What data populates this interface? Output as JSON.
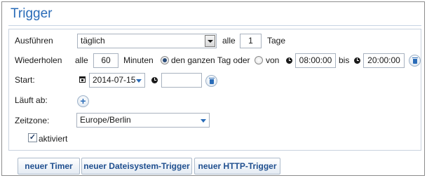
{
  "title": "Trigger",
  "row_execute": {
    "label": "Ausführen",
    "frequency_value": "täglich",
    "every_label": "alle",
    "every_value": "1",
    "unit_label": "Tage"
  },
  "row_repeat": {
    "label": "Wiederholen",
    "every_label": "alle",
    "minutes_value": "60",
    "minutes_label": "Minuten",
    "all_day_label": "den ganzen Tag oder",
    "all_day_selected": true,
    "from_label": "von",
    "from_value": "08:00:00",
    "to_label": "bis",
    "to_value": "20:00:00"
  },
  "row_start": {
    "label": "Start:",
    "date_value": "2014-07-15",
    "time_value": ""
  },
  "row_expires": {
    "label": "Läuft ab:"
  },
  "row_timezone": {
    "label": "Zeitzone:",
    "value": "Europe/Berlin"
  },
  "activated": {
    "label": "aktiviert",
    "checked": true
  },
  "buttons": {
    "new_timer": "neuer Timer",
    "new_filesystem_trigger": "neuer Dateisystem-Trigger",
    "new_http_trigger": "neuer HTTP-Trigger"
  },
  "colors": {
    "accent": "#2a6cb8",
    "button_text": "#1f4f8f",
    "panel_border": "#c9d3df"
  },
  "icons": [
    "calendar-icon",
    "clock-icon",
    "trash-icon",
    "plus-icon",
    "chevron-down-icon"
  ]
}
